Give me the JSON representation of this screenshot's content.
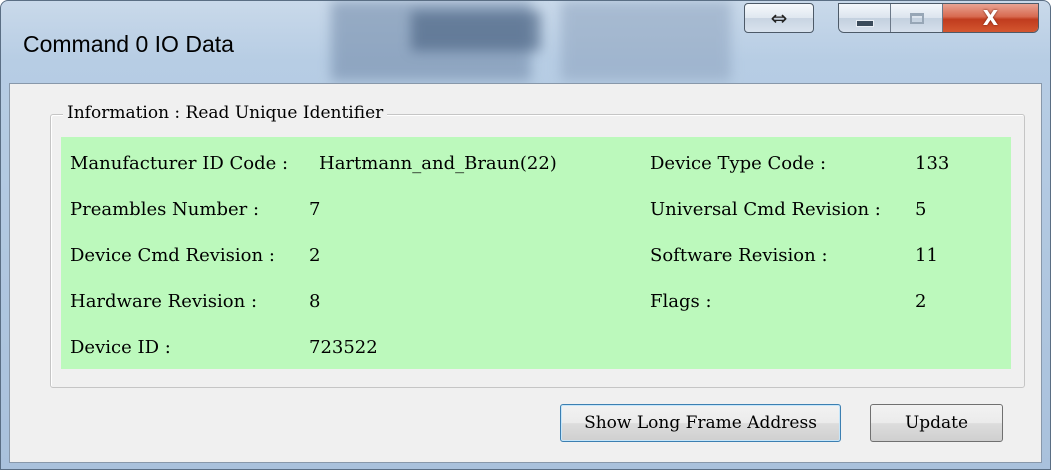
{
  "window": {
    "title": "Command 0 IO Data",
    "controls": {
      "swap_icon": "⇔",
      "minimize_icon": "minimize-icon",
      "maximize_icon": "maximize-icon",
      "close_icon": "X"
    }
  },
  "group": {
    "label": "Information : Read Unique Identifier",
    "panel_color": "#bcf9bc",
    "fields": [
      {
        "label": "Manufacturer ID Code :",
        "value": "Hartmann_and_Braun(22)"
      },
      {
        "label": "Device Type Code :",
        "value": "133"
      },
      {
        "label": "Preambles Number :",
        "value": "7"
      },
      {
        "label": "Universal Cmd Revision :",
        "value": "5"
      },
      {
        "label": "Device Cmd Revision :",
        "value": "2"
      },
      {
        "label": "Software Revision :",
        "value": "11"
      },
      {
        "label": "Hardware Revision :",
        "value": "8"
      },
      {
        "label": "Flags :",
        "value": "2"
      },
      {
        "label": "Device ID :",
        "value": "723522"
      }
    ]
  },
  "buttons": {
    "show_long_frame": "Show Long Frame Address",
    "update": "Update"
  }
}
